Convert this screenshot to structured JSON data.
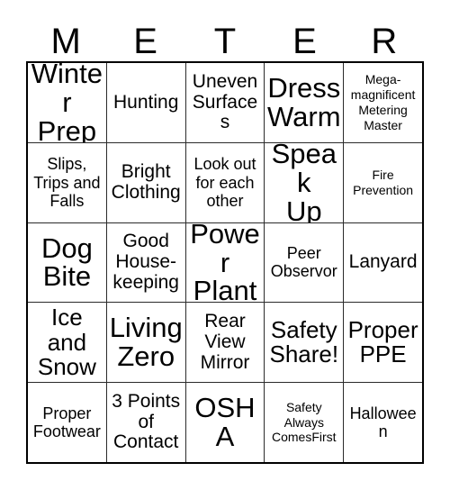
{
  "card": {
    "header_letters": [
      "M",
      "E",
      "T",
      "E",
      "R"
    ],
    "rows": [
      [
        {
          "text": "Winter\nPrep",
          "size": "xl"
        },
        {
          "text": "Hunting",
          "size": "md"
        },
        {
          "text": "Uneven\nSurfaces",
          "size": "md"
        },
        {
          "text": "Dress\nWarm",
          "size": "xl"
        },
        {
          "text": "Mega-\nmagnificent\nMetering\nMaster",
          "size": "xs"
        }
      ],
      [
        {
          "text": "Slips,\nTrips and\nFalls",
          "size": "sm"
        },
        {
          "text": "Bright\nClothing",
          "size": "md"
        },
        {
          "text": "Look out\nfor each\nother",
          "size": "sm"
        },
        {
          "text": "Speak\nUp",
          "size": "xl"
        },
        {
          "text": "Fire\nPrevention",
          "size": "xs"
        }
      ],
      [
        {
          "text": "Dog\nBite",
          "size": "xl"
        },
        {
          "text": "Good\nHouse-\nkeeping",
          "size": "md"
        },
        {
          "text": "Power\nPlant",
          "size": "xl"
        },
        {
          "text": "Peer\nObservor",
          "size": "sm"
        },
        {
          "text": "Lanyard",
          "size": "md"
        }
      ],
      [
        {
          "text": "Ice and\nSnow",
          "size": "lg"
        },
        {
          "text": "Living\nZero",
          "size": "xl"
        },
        {
          "text": "Rear\nView\nMirror",
          "size": "md"
        },
        {
          "text": "Safety\nShare!",
          "size": "lg"
        },
        {
          "text": "Proper\nPPE",
          "size": "lg"
        }
      ],
      [
        {
          "text": "Proper\nFootwear",
          "size": "sm"
        },
        {
          "text": "3 Points\nof\nContact",
          "size": "md"
        },
        {
          "text": "OSHA",
          "size": "xl"
        },
        {
          "text": "Safety\nAlways\nComesFirst",
          "size": "xs"
        },
        {
          "text": "Halloween",
          "size": "sm"
        }
      ]
    ]
  },
  "colors": {
    "background": "#ffffff",
    "text": "#000000",
    "outer_border": "#000000",
    "inner_border": "#2b2b2b"
  }
}
